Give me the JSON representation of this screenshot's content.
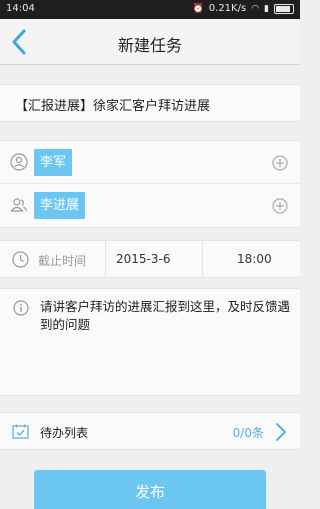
{
  "status_bar": {
    "time": "14:04",
    "speed": "0.21K/s",
    "battery_icon": "battery-icon",
    "wifi_icon": "wifi-icon",
    "signal_icon": "signal-icon"
  },
  "nav": {
    "title": "新建任务",
    "back_icon": "back-icon"
  },
  "task": {
    "title": "【汇报进展】徐家汇客户拜访进展"
  },
  "people": {
    "assignee": {
      "name": "李军",
      "icon": "person-icon"
    },
    "participant": {
      "name": "李进展",
      "icon": "person-group-icon"
    },
    "add_icon": "plus-circle-icon"
  },
  "due": {
    "label": "截止时间",
    "date": "2015-3-6",
    "time": "18:00",
    "icon": "clock-icon"
  },
  "description": {
    "text": "请讲客户拜访的进展汇报到这里，及时反馈遇到的问题",
    "icon": "info-icon"
  },
  "todo": {
    "label": "待办列表",
    "count": "0/0条",
    "icon": "calendar-check-icon",
    "chevron_icon": "chevron-right-icon"
  },
  "publish": {
    "label": "发布"
  },
  "colors": {
    "accent": "#6cc6f2",
    "link": "#5aaede",
    "background": "#efeff2",
    "statusbar": "#1e1e1e"
  }
}
